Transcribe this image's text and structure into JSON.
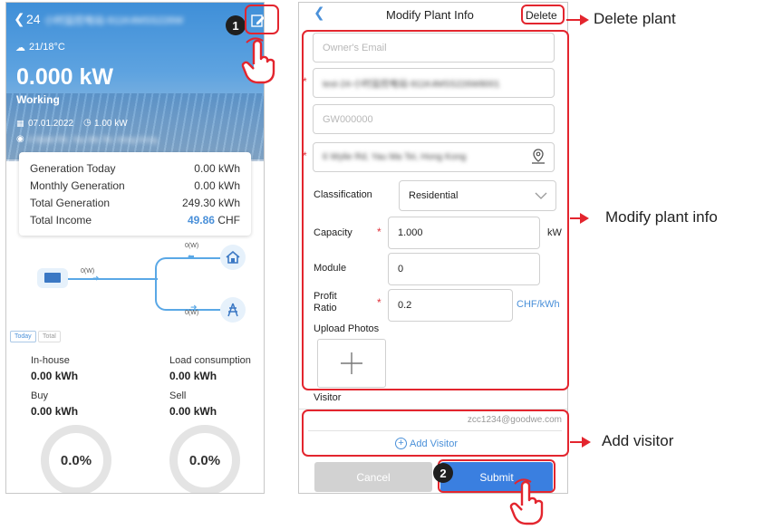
{
  "left": {
    "title_prefix": "24",
    "title_blurred": "小时监控电站-911K4MSS226W",
    "weather": "21/18°C",
    "power": "0.000 kW",
    "status": "Working",
    "date": "07.01.2022",
    "capacity": "1.00 kW",
    "address_blurred": "6 Wylie Rd, Yau Ma Tei, Hong Kong",
    "stats": [
      {
        "label": "Generation Today",
        "value": "0.00 kWh"
      },
      {
        "label": "Monthly Generation",
        "value": "0.00 kWh"
      },
      {
        "label": "Total Generation",
        "value": "249.30 kWh"
      },
      {
        "label": "Total Income",
        "value": "49.86",
        "unit": "CHF"
      }
    ],
    "flow": {
      "pv": "0(W)",
      "home": "0(W)",
      "grid": "0(W)"
    },
    "tabs": [
      "Today",
      "Total"
    ],
    "energy": [
      {
        "label": "In-house",
        "value": "0.00 kWh"
      },
      {
        "label": "Load consumption",
        "value": "0.00 kWh"
      },
      {
        "label": "Buy",
        "value": "0.00 kWh"
      },
      {
        "label": "Sell",
        "value": "0.00 kWh"
      }
    ],
    "rings": [
      "0.0%",
      "0.0%"
    ]
  },
  "right": {
    "title": "Modify Plant Info",
    "delete_label": "Delete",
    "owner_email_placeholder": "Owner's Email",
    "plant_name_blurred": "test-24-小时监控电站-911K4MSS226W8001",
    "sn_placeholder": "GW000000",
    "address_blurred": "6 Wylie Rd, Yau Ma Tei, Hong Kong",
    "classification_label": "Classification",
    "classification_value": "Residential",
    "capacity_label": "Capacity",
    "capacity_value": "1.000",
    "capacity_unit": "kW",
    "module_label": "Module",
    "module_value": "0",
    "profit_label_1": "Profit",
    "profit_label_2": "Ratio",
    "profit_value": "0.2",
    "profit_unit": "CHF/kWh",
    "upload_label": "Upload Photos",
    "visitor_label": "Visitor",
    "visitor_email": "zcc1234@goodwe.com",
    "add_visitor_label": "Add Visitor",
    "cancel_label": "Cancel",
    "submit_label": "Submit"
  },
  "callouts": {
    "delete": "Delete plant",
    "modify": "Modify plant info",
    "visitor": "Add visitor",
    "step1": "1",
    "step2": "2"
  },
  "colors": {
    "accent": "#4a90d9",
    "highlight": "#e3252e",
    "submit": "#3a7fe0"
  }
}
